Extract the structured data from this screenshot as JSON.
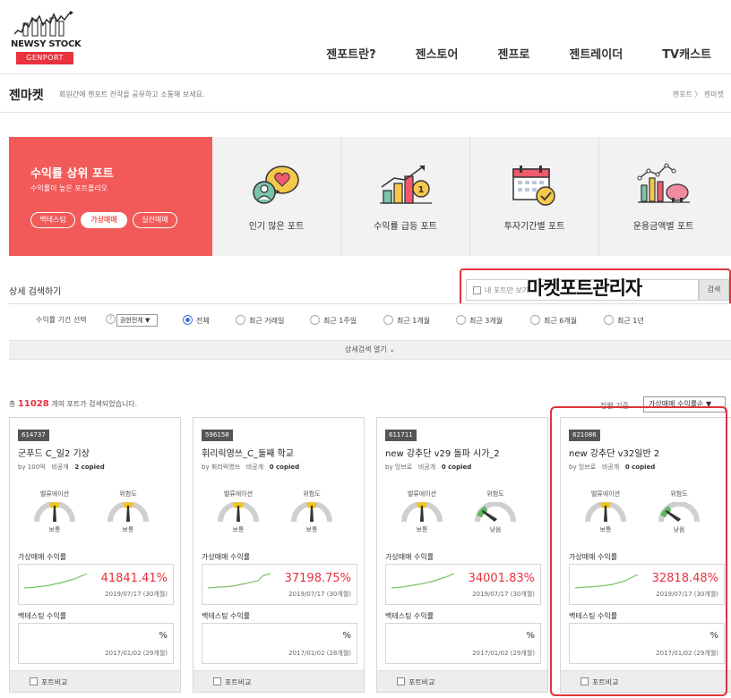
{
  "logo": {
    "brand": "NEWSY STOCK",
    "badge": "GENPORT"
  },
  "nav": [
    "젠포트란?",
    "젠스토어",
    "젠프로",
    "젠트레이더",
    "TV캐스트"
  ],
  "page": {
    "title": "젠마켓",
    "subtitle": "회원간에 젠포트 전략을 공유하고 소통해 보세요.",
    "breadcrumb": "젠포트  〉 젠마켓"
  },
  "categories": {
    "featured": {
      "title": "수익률 상위 포트",
      "subtitle": "수익률이 높은 포트폴리오",
      "pills": [
        "백테스팅",
        "가상매매",
        "실전매매"
      ],
      "active_pill": 1
    },
    "tiles": [
      "인기 많은 포트",
      "수익률 급등 포트",
      "투자기간별 포트",
      "운용금액별 포트"
    ]
  },
  "search": {
    "title": "상세 검색하기",
    "my_port_label": "내 포트만 보기",
    "button": "검색",
    "overlay_label": "마켓포트관리자",
    "period_label": "수익률 기간 선택",
    "period_select": "권한전체 ▼",
    "periods": [
      "전체",
      "최근 거래일",
      "최근 1주일",
      "최근 1개월",
      "최근 3개월",
      "최근 6개월",
      "최근 1년"
    ],
    "selected_period": 0,
    "detail_toggle": "상세검색 열기 ⌄"
  },
  "results": {
    "total_prefix": "총",
    "total_count": "11028",
    "total_suffix": "개의 포트가 검색되었습니다.",
    "sort_label": "정렬 기준",
    "sort_value": "가상매매 수익률순  ▼"
  },
  "card_labels": {
    "valuation": "밸류에이션",
    "risk": "위험도",
    "virtual": "가상매매 수익률",
    "backtest": "백테스팅 수익률",
    "compare": "포트비교"
  },
  "cards": [
    {
      "code": "614737",
      "name": "군푸드 C_일2 기상",
      "author": "by 100억",
      "visibility": "비공개",
      "copied": "2 copied",
      "valuation": "보통",
      "risk": "보통",
      "risk_color": "#f0c419",
      "return": "41841.41%",
      "return_date": "2019/07/17 (30개월)",
      "backtest": "%",
      "backtest_date": "2017/01/02 (29개월)"
    },
    {
      "code": "596158",
      "name": "휘리릭영쓰_C_둘째 학교",
      "author": "by 휘리릭영쓰",
      "visibility": "비공개",
      "copied": "0 copied",
      "valuation": "보통",
      "risk": "보통",
      "risk_color": "#f0c419",
      "return": "37198.75%",
      "return_date": "2019/07/17 (30개월)",
      "backtest": "%",
      "backtest_date": "2017/01/02 (28개월)"
    },
    {
      "code": "611711",
      "name": "new 강추단 v29 돌파 시가_2",
      "author": "by 잉브로",
      "visibility": "비공개",
      "copied": "0 copied",
      "valuation": "보통",
      "risk": "낮음",
      "risk_color": "#5cb85c",
      "return": "34001.83%",
      "return_date": "2019/07/17 (30개월)",
      "backtest": "%",
      "backtest_date": "2017/01/02 (29개월)"
    },
    {
      "code": "621086",
      "name": "new 강추단 v32일반 2",
      "author": "by 잉브로",
      "visibility": "비공개",
      "copied": "0 copied",
      "valuation": "보통",
      "risk": "낮음",
      "risk_color": "#5cb85c",
      "return": "32818.48%",
      "return_date": "2019/07/17 (30개월)",
      "backtest": "%",
      "backtest_date": "2017/01/02 (29개월)"
    }
  ],
  "colors": {
    "accent": "#f25a5a",
    "highlight": "#e0333a",
    "return": "#e8323c"
  }
}
